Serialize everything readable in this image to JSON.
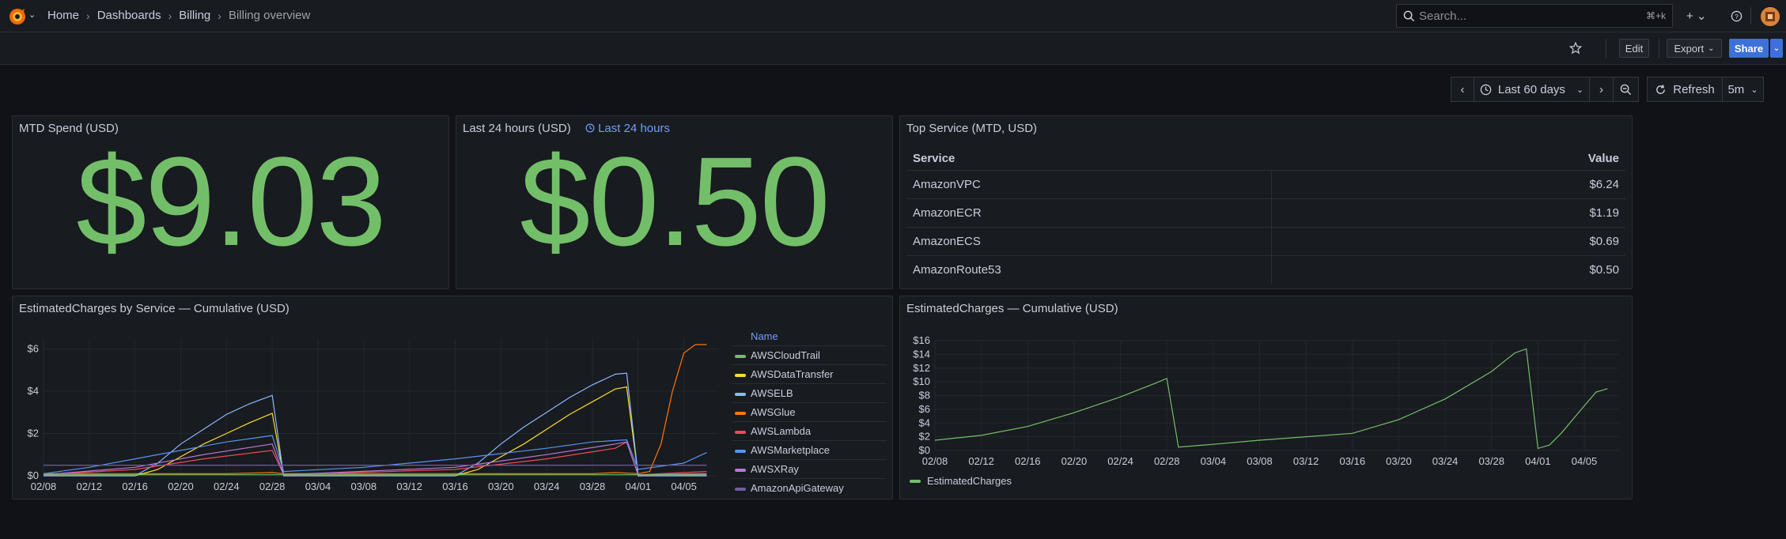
{
  "breadcrumb": {
    "items": [
      "Home",
      "Dashboards",
      "Billing"
    ],
    "current": "Billing overview"
  },
  "search": {
    "placeholder": "Search...",
    "shortcut": "⌘+k"
  },
  "actions": {
    "edit": "Edit",
    "export": "Export",
    "share": "Share"
  },
  "timepicker": {
    "range": "Last 60 days",
    "refresh": "Refresh",
    "interval": "5m"
  },
  "panels": {
    "mtd": {
      "title": "MTD Spend (USD)",
      "value": "$9.03",
      "color": "#73bf69"
    },
    "last24": {
      "title": "Last 24 hours (USD)",
      "time_override": "Last 24 hours",
      "value": "$0.50",
      "color": "#73bf69"
    },
    "top_service": {
      "title": "Top Service (MTD, USD)",
      "columns": [
        "Service",
        "Value"
      ],
      "rows": [
        [
          "AmazonVPC",
          "$6.24"
        ],
        [
          "AmazonECR",
          "$1.19"
        ],
        [
          "AmazonECS",
          "$0.69"
        ],
        [
          "AmazonRoute53",
          "$0.50"
        ]
      ]
    },
    "by_service": {
      "title": "EstimatedCharges by Service — Cumulative (USD)",
      "legend_header": "Name",
      "legend": [
        {
          "name": "AWSCloudTrail",
          "color": "#73bf69"
        },
        {
          "name": "AWSDataTransfer",
          "color": "#fade2a"
        },
        {
          "name": "AWSELB",
          "color": "#8ab8ff"
        },
        {
          "name": "AWSGlue",
          "color": "#ff780a"
        },
        {
          "name": "AWSLambda",
          "color": "#f2495c"
        },
        {
          "name": "AWSMarketplace",
          "color": "#5794f2"
        },
        {
          "name": "AWSXRay",
          "color": "#b877d9"
        },
        {
          "name": "AmazonApiGateway",
          "color": "#705da0"
        }
      ]
    },
    "total": {
      "title": "EstimatedCharges — Cumulative (USD)",
      "legend": [
        {
          "name": "EstimatedCharges",
          "color": "#73bf69"
        }
      ]
    }
  },
  "chart_data": [
    {
      "type": "line",
      "title": "EstimatedCharges by Service — Cumulative (USD)",
      "x_ticks": [
        "02/08",
        "02/12",
        "02/16",
        "02/20",
        "02/24",
        "02/28",
        "03/04",
        "03/08",
        "03/12",
        "03/16",
        "03/20",
        "03/24",
        "03/28",
        "04/01",
        "04/05"
      ],
      "y_ticks": [
        "$0",
        "$2",
        "$4",
        "$6"
      ],
      "ylim": [
        0,
        6.5
      ],
      "grid": true,
      "legend_position": "right",
      "series": [
        {
          "name": "AWSGlue",
          "color": "#ff780a",
          "x": [
            "02/08",
            "02/20",
            "02/24",
            "02/28",
            "03/01",
            "03/16",
            "03/20",
            "03/24",
            "03/28",
            "03/30",
            "04/01",
            "04/02",
            "04/03",
            "04/04",
            "04/05",
            "04/06",
            "04/07"
          ],
          "y": [
            0.1,
            0.1,
            0.1,
            0.15,
            0.1,
            0.1,
            0.1,
            0.1,
            0.1,
            0.15,
            0.1,
            0.2,
            1.5,
            4.0,
            5.8,
            6.2,
            6.2
          ]
        },
        {
          "name": "AWSDataTransfer",
          "color": "#fade2a",
          "x": [
            "02/08",
            "02/16",
            "02/18",
            "02/20",
            "02/22",
            "02/24",
            "02/26",
            "02/28",
            "03/01",
            "03/16",
            "03/18",
            "03/20",
            "03/22",
            "03/24",
            "03/26",
            "03/28",
            "03/30",
            "03/31",
            "04/01",
            "04/07"
          ],
          "y": [
            0,
            0,
            0.3,
            0.9,
            1.5,
            2.0,
            2.5,
            2.95,
            0,
            0,
            0.3,
            0.9,
            1.5,
            2.2,
            2.9,
            3.5,
            4.1,
            4.2,
            0,
            0
          ]
        },
        {
          "name": "AWSELB",
          "color": "#8ab8ff",
          "x": [
            "02/08",
            "02/16",
            "02/18",
            "02/20",
            "02/22",
            "02/24",
            "02/26",
            "02/28",
            "03/01",
            "03/16",
            "03/18",
            "03/20",
            "03/22",
            "03/24",
            "03/26",
            "03/28",
            "03/30",
            "03/31",
            "04/01",
            "04/07"
          ],
          "y": [
            0,
            0,
            0.6,
            1.5,
            2.2,
            2.9,
            3.4,
            3.8,
            0,
            0,
            0.6,
            1.5,
            2.3,
            3.0,
            3.7,
            4.3,
            4.8,
            4.85,
            0,
            0
          ]
        },
        {
          "name": "AWSMarketplace",
          "color": "#5794f2",
          "x": [
            "02/08",
            "02/12",
            "02/16",
            "02/20",
            "02/24",
            "02/28",
            "03/01",
            "03/08",
            "03/16",
            "03/24",
            "03/28",
            "03/31",
            "04/01",
            "04/05",
            "04/07"
          ],
          "y": [
            0.1,
            0.4,
            0.8,
            1.2,
            1.6,
            1.9,
            0.2,
            0.4,
            0.8,
            1.3,
            1.6,
            1.7,
            0.3,
            0.6,
            1.1
          ]
        },
        {
          "name": "AWSLambda",
          "color": "#f2495c",
          "x": [
            "02/08",
            "02/16",
            "02/22",
            "02/28",
            "03/01",
            "03/16",
            "03/24",
            "03/30",
            "03/31",
            "04/01",
            "04/07"
          ],
          "y": [
            0.05,
            0.3,
            0.8,
            1.2,
            0.05,
            0.3,
            0.8,
            1.3,
            1.6,
            0.05,
            0.2
          ]
        },
        {
          "name": "AWSXRay",
          "color": "#b877d9",
          "x": [
            "02/08",
            "02/16",
            "02/22",
            "02/28",
            "03/01",
            "03/16",
            "03/24",
            "03/30",
            "03/31",
            "04/01",
            "04/07"
          ],
          "y": [
            0.05,
            0.4,
            1.0,
            1.5,
            0.05,
            0.4,
            1.0,
            1.5,
            1.6,
            0.05,
            0.1
          ]
        },
        {
          "name": "AmazonApiGateway",
          "color": "#705da0",
          "x": [
            "02/08",
            "02/28",
            "03/01",
            "03/31",
            "04/01",
            "04/07"
          ],
          "y": [
            0.5,
            0.5,
            0.5,
            0.5,
            0.5,
            0.5
          ]
        },
        {
          "name": "AWSCloudTrail",
          "color": "#73bf69",
          "x": [
            "02/08",
            "04/07"
          ],
          "y": [
            0.05,
            0.05
          ]
        }
      ]
    },
    {
      "type": "line",
      "title": "EstimatedCharges — Cumulative (USD)",
      "x_ticks": [
        "02/08",
        "02/12",
        "02/16",
        "02/20",
        "02/24",
        "02/28",
        "03/04",
        "03/08",
        "03/12",
        "03/16",
        "03/20",
        "03/24",
        "03/28",
        "04/01",
        "04/05"
      ],
      "y_ticks": [
        "$0",
        "$2",
        "$4",
        "$6",
        "$8",
        "$10",
        "$12",
        "$14",
        "$16"
      ],
      "ylim": [
        0,
        16
      ],
      "grid": true,
      "legend_position": "bottom",
      "series": [
        {
          "name": "EstimatedCharges",
          "color": "#73bf69",
          "x": [
            "02/08",
            "02/12",
            "02/16",
            "02/20",
            "02/24",
            "02/27",
            "02/28",
            "03/01",
            "03/04",
            "03/08",
            "03/12",
            "03/16",
            "03/20",
            "03/24",
            "03/28",
            "03/30",
            "03/31",
            "04/01",
            "04/02",
            "04/03",
            "04/05",
            "04/06",
            "04/07"
          ],
          "y": [
            1.5,
            2.2,
            3.5,
            5.5,
            7.8,
            9.8,
            10.5,
            0.5,
            0.9,
            1.5,
            2.0,
            2.5,
            4.5,
            7.5,
            11.5,
            14.2,
            14.8,
            0.3,
            0.8,
            2.5,
            6.5,
            8.5,
            9.0
          ]
        }
      ]
    }
  ]
}
